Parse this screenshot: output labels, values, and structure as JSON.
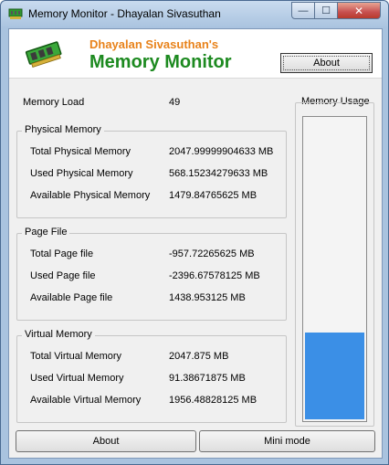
{
  "window": {
    "title": "Memory Monitor - Dhayalan Sivasuthan",
    "min_glyph": "—",
    "max_glyph": "☐",
    "close_glyph": "✕"
  },
  "header": {
    "subtitle": "Dhayalan Sivasuthan's",
    "title": "Memory Monitor",
    "about_label": "About"
  },
  "memory_load": {
    "label": "Memory Load",
    "value": "49"
  },
  "physical": {
    "title": "Physical Memory",
    "rows": [
      {
        "label": "Total Physical Memory",
        "value": "2047.99999904633 MB"
      },
      {
        "label": "Used Physical Memory",
        "value": "568.15234279633 MB"
      },
      {
        "label": "Available Physical Memory",
        "value": "1479.84765625 MB"
      }
    ]
  },
  "page_file": {
    "title": "Page File",
    "rows": [
      {
        "label": "Total Page file",
        "value": "-957.72265625 MB"
      },
      {
        "label": "Used Page file",
        "value": "-2396.67578125 MB"
      },
      {
        "label": "Available Page file",
        "value": "1438.953125 MB"
      }
    ]
  },
  "virtual": {
    "title": "Virtual Memory",
    "rows": [
      {
        "label": "Total Virtual Memory",
        "value": "2047.875 MB"
      },
      {
        "label": "Used Virtual Memory",
        "value": "91.38671875 MB"
      },
      {
        "label": "Available Virtual Memory",
        "value": "1956.48828125 MB"
      }
    ]
  },
  "usage": {
    "title": "Memory Usage",
    "level_fraction": 0.29,
    "fill_color": "#3b8fe6"
  },
  "buttons": {
    "about": "About",
    "mini_mode": "Mini mode"
  }
}
